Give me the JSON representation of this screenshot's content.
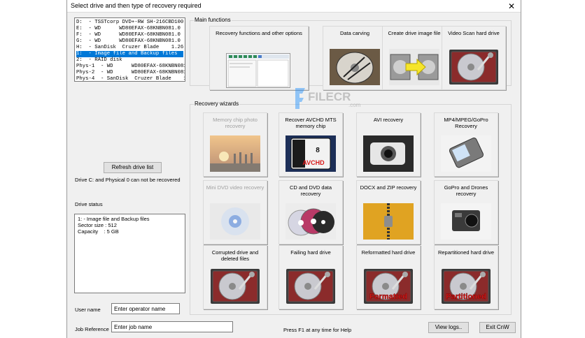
{
  "window": {
    "title": "Select drive and then type of recovery required",
    "close_label": "✕"
  },
  "drives": [
    "D:  - TSSTcorp DVD+-RW SH-216CBD100",
    "E:  - WD      WD80EFAX-68KNBN081.0",
    "F:  - WD      WD80EFAX-68KNBN081.0",
    "G:  - WD      WD80EFAX-68KNBN081.0",
    "H:  - SanDisk  Cruzer Blade    1.26",
    "1:  - Image file and Backup files",
    "2:  - RAID disk",
    "Phys-1  - WD      WD80EFAX-68KNBN081.0",
    "Phys-2  - WD      WD80EFAX-68KNBN081.0",
    "Phys-4  - SanDisk  Cruzer Blade    1.26"
  ],
  "selected_drive_index": 5,
  "refresh_label": "Refresh drive list",
  "drive_note": "Drive C: and Physical 0 can not be recovered",
  "drive_status_label": "Drive status",
  "drive_status_lines": [
    "1: - Image file and Backup files",
    "Sector size : 512",
    "Capacity    : 5 GB"
  ],
  "user_name_label": "User name",
  "user_name_value": "Enter operator name",
  "job_reference_label": "Job Reference",
  "job_reference_value": "Enter job name",
  "help_text": "Press F1 at any time for Help",
  "view_logs_label": "View logs..",
  "exit_label": "Exit CnW",
  "main_functions_label": "Main functions",
  "main_functions": [
    {
      "label": "Recovery functions and other options",
      "icon": "screenshot-icon"
    },
    {
      "label": "Data carving",
      "icon": "carving-disk-icon"
    },
    {
      "label": "Create drive image file",
      "icon": "image-copy-icon"
    },
    {
      "label": "Video Scan hard drive",
      "icon": "hard-drive-icon"
    }
  ],
  "recovery_wizards_label": "Recovery wizards",
  "wizards": [
    {
      "label": "Memory chip photo recovery",
      "enabled": false,
      "icon": "sunset-photo-icon"
    },
    {
      "label": "Recover AVCHD MTS memory chip",
      "enabled": true,
      "icon": "sd-card-icon",
      "overlay": "AVCHD"
    },
    {
      "label": "AVI recovery",
      "enabled": true,
      "icon": "camera-icon"
    },
    {
      "label": "MP4/MPEG/GoPro Recovery",
      "enabled": true,
      "icon": "phone-icon"
    },
    {
      "label": "Mini DVD video recovery",
      "enabled": false,
      "icon": "disc-icon"
    },
    {
      "label": "CD and DVD data recovery",
      "enabled": true,
      "icon": "cds-icon"
    },
    {
      "label": "DOCX and ZIP recovery",
      "enabled": true,
      "icon": "zip-icon"
    },
    {
      "label": "GoPro and Drones recovery",
      "enabled": true,
      "icon": "gopro-icon"
    },
    {
      "label": "Corrupted drive and deleted files",
      "enabled": true,
      "icon": "hard-drive-icon"
    },
    {
      "label": "Failing hard drive",
      "enabled": true,
      "icon": "hard-drive-icon"
    },
    {
      "label": "Reformatted hard drive",
      "enabled": true,
      "icon": "hard-drive-icon",
      "overlay": "Formatted"
    },
    {
      "label": "Repartitioned hard drive",
      "enabled": true,
      "icon": "hard-drive-icon",
      "overlay": "Partitioned"
    }
  ],
  "watermark": {
    "brand": "FILECR",
    "sub": ".com"
  },
  "colors": {
    "selection": "#0078d7",
    "window_bg": "#f0f0f0",
    "overlay_red": "#d81818"
  }
}
